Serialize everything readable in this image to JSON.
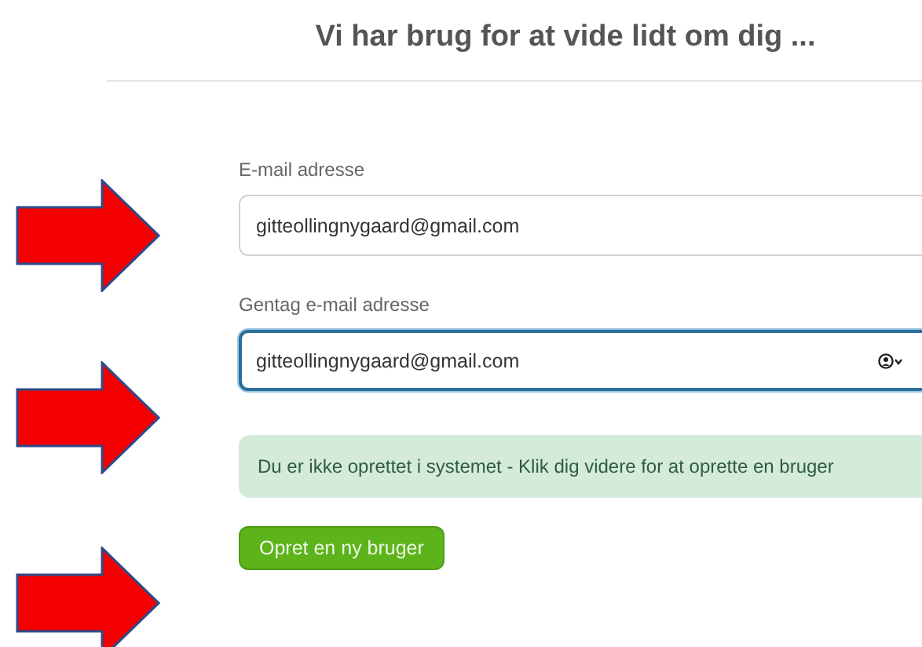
{
  "heading": "Vi har brug for at vide lidt om dig ...",
  "fields": [
    {
      "label": "E-mail adresse",
      "value": "gitteollingnygaard@gmail.com",
      "focused": false,
      "autofill_icon": false
    },
    {
      "label": "Gentag e-mail adresse",
      "value": "gitteollingnygaard@gmail.com",
      "focused": true,
      "autofill_icon": true
    }
  ],
  "alert": {
    "text": "Du er ikke oprettet i systemet - Klik dig videre for at oprette en bruger"
  },
  "button": {
    "label": "Opret en ny bruger"
  }
}
